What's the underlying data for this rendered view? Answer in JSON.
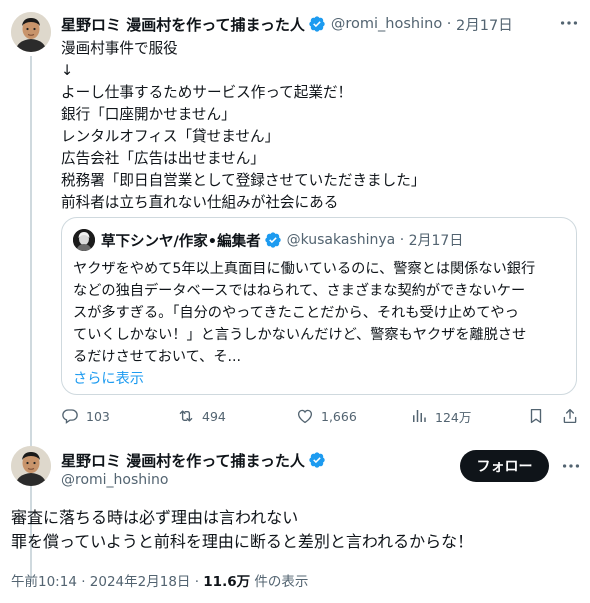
{
  "tweet1": {
    "name": "星野ロミ 漫画村を作って捕まった人",
    "handle": "@romi_hoshino",
    "date": "2月17日",
    "lines": [
      "漫画村事件で服役",
      "↓",
      "よーし仕事するためサービス作って起業だ！",
      "銀行「口座開かせません」",
      "レンタルオフィス「貸せません」",
      "広告会社「広告は出せません」",
      "税務署「即日自営業として登録させていただきました」",
      "前科者は立ち直れない仕組みが社会にある"
    ],
    "quote": {
      "name": "草下シンヤ/作家•編集者",
      "handle": "@kusakashinya",
      "date": "2月17日",
      "lines": [
        "ヤクザをやめて5年以上真面目に働いているのに、警察とは関係ない銀行",
        "などの独自データベースではねられて、さまざまな契約ができないケー",
        "スが多すぎる。「自分のやってきたことだから、それも受け止めてやっ",
        "ていくしかない！」と言うしかないんだけど、警察もヤクザを離脱させ",
        "るだけさせておいて、そ..."
      ],
      "show_more": "さらに表示"
    },
    "stats": {
      "replies": "103",
      "retweets": "494",
      "likes": "1,666",
      "views": "124万"
    }
  },
  "tweet2": {
    "name": "星野ロミ 漫画村を作って捕まった人",
    "handle": "@romi_hoshino",
    "follow_label": "フォロー",
    "lines": [
      "審査に落ちる時は必ず理由は言われない",
      "罪を償っていようと前科を理由に断ると差別と言われるからな！"
    ],
    "timestamp": "午前10:14 · 2024年2月18日 · ",
    "views_count": "11.6万",
    "views_suffix": " 件の表示"
  },
  "colors": {
    "text": "#0f1419",
    "secondary": "#536471",
    "accent": "#1d9bf0",
    "border": "#cfd9de",
    "follow_bg": "#0f1419"
  },
  "icons": [
    "verified-badge-icon",
    "more-icon",
    "reply-icon",
    "retweet-icon",
    "like-icon",
    "views-icon",
    "bookmark-icon",
    "share-icon"
  ]
}
